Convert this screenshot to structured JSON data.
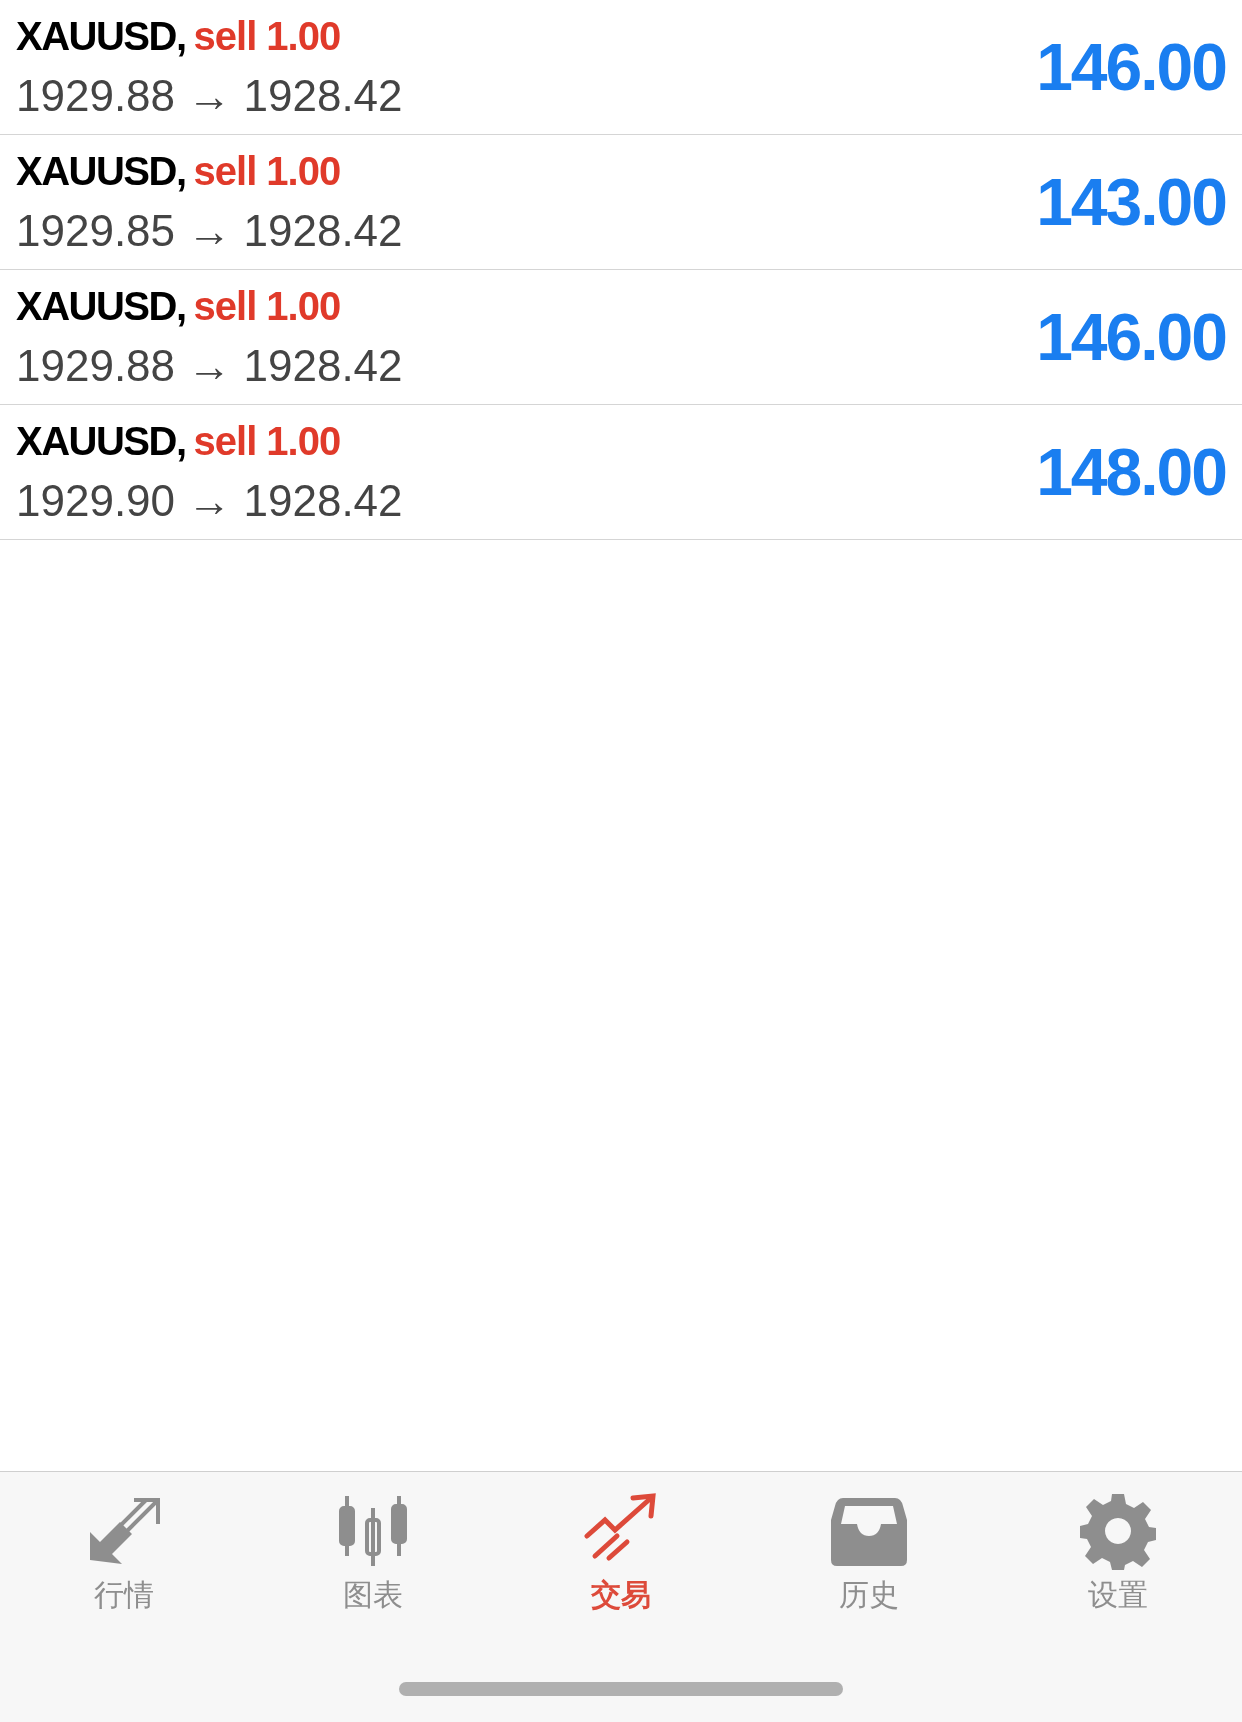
{
  "positions": [
    {
      "symbol": "XAUUSD,",
      "order": "sell 1.00",
      "prices": "1929.88 → 1928.42",
      "profit": "146.00"
    },
    {
      "symbol": "XAUUSD,",
      "order": "sell 1.00",
      "prices": "1929.85 → 1928.42",
      "profit": "143.00"
    },
    {
      "symbol": "XAUUSD,",
      "order": "sell 1.00",
      "prices": "1929.88 → 1928.42",
      "profit": "146.00"
    },
    {
      "symbol": "XAUUSD,",
      "order": "sell 1.00",
      "prices": "1929.90 → 1928.42",
      "profit": "148.00"
    }
  ],
  "tab_bar": [
    {
      "label": "行情",
      "selected": false
    },
    {
      "label": "图表",
      "selected": false
    },
    {
      "label": "交易",
      "selected": true
    },
    {
      "label": "历史",
      "selected": false
    },
    {
      "label": "设置",
      "selected": false
    }
  ]
}
